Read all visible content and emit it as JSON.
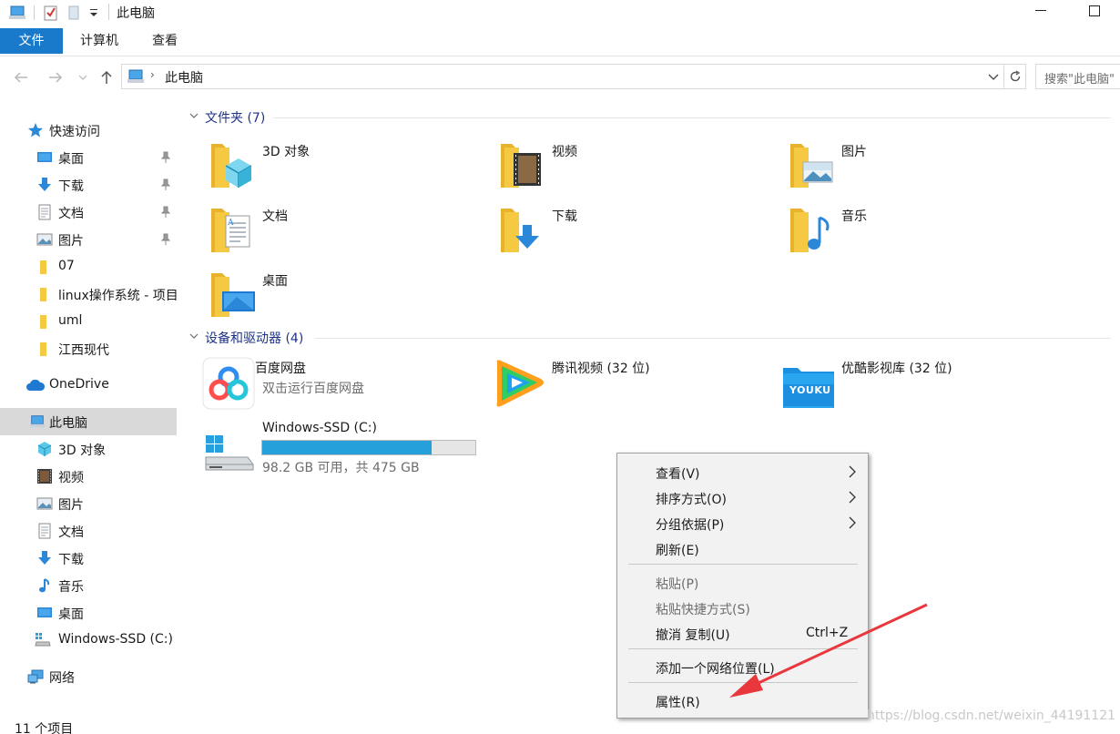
{
  "window": {
    "title": "此电脑"
  },
  "ribbon": {
    "tabs": [
      "文件",
      "计算机",
      "查看"
    ]
  },
  "address": {
    "path": "此电脑",
    "search_placeholder": "搜索\"此电脑\""
  },
  "sidebar": {
    "quick_access": "快速访问",
    "pinned": [
      {
        "label": "桌面",
        "icon": "desktop-icon"
      },
      {
        "label": "下载",
        "icon": "download-icon"
      },
      {
        "label": "文档",
        "icon": "document-icon"
      },
      {
        "label": "图片",
        "icon": "pictures-icon"
      }
    ],
    "recent": [
      "07",
      "linux操作系统 - 项目",
      "uml",
      "江西现代"
    ],
    "onedrive": "OneDrive",
    "this_pc": "此电脑",
    "this_pc_children": [
      {
        "label": "3D 对象",
        "icon": "3d-objects-icon"
      },
      {
        "label": "视频",
        "icon": "videos-icon"
      },
      {
        "label": "图片",
        "icon": "pictures-icon"
      },
      {
        "label": "文档",
        "icon": "document-icon"
      },
      {
        "label": "下载",
        "icon": "download-icon"
      },
      {
        "label": "音乐",
        "icon": "music-icon"
      },
      {
        "label": "桌面",
        "icon": "desktop-icon"
      },
      {
        "label": "Windows-SSD (C:)",
        "icon": "drive-icon"
      }
    ],
    "network": "网络"
  },
  "content": {
    "folders_header": "文件夹 (7)",
    "folders": [
      {
        "name": "3D 对象",
        "icon": "3d-objects-icon"
      },
      {
        "name": "视频",
        "icon": "videos-icon"
      },
      {
        "name": "图片",
        "icon": "pictures-icon"
      },
      {
        "name": "文档",
        "icon": "document-icon"
      },
      {
        "name": "下载",
        "icon": "download-icon"
      },
      {
        "name": "音乐",
        "icon": "music-icon"
      },
      {
        "name": "桌面",
        "icon": "desktop-icon"
      }
    ],
    "devices_header": "设备和驱动器 (4)",
    "devices": [
      {
        "name": "百度网盘",
        "sub": "双击运行百度网盘",
        "icon": "baidu-netdisk-icon"
      },
      {
        "name": "腾讯视频 (32 位)",
        "icon": "tencent-video-icon"
      },
      {
        "name": "优酷影视库 (32 位)",
        "icon": "youku-icon",
        "logo_text": "YOUKU"
      }
    ],
    "drive": {
      "name": "Windows-SSD (C:)",
      "free_text": "98.2 GB 可用，共 475 GB",
      "used_fraction": 0.793,
      "icon": "drive-icon"
    }
  },
  "context_menu": {
    "items": [
      {
        "label": "查看(V)",
        "submenu": true
      },
      {
        "label": "排序方式(O)",
        "submenu": true
      },
      {
        "label": "分组依据(P)",
        "submenu": true
      },
      {
        "label": "刷新(E)"
      },
      {
        "label": "粘贴(P)",
        "disabled": true
      },
      {
        "label": "粘贴快捷方式(S)",
        "disabled": true
      },
      {
        "label": "撤消 复制(U)",
        "shortcut": "Ctrl+Z"
      },
      {
        "label": "添加一个网络位置(L)"
      },
      {
        "label": "属性(R)"
      }
    ]
  },
  "status": {
    "item_count": "11 个项目"
  },
  "watermark": "https://blog.csdn.net/weixin_44191121",
  "colors": {
    "accent": "#1979ca",
    "folder": "#f5c942",
    "drive_bar": "#26a0da",
    "annotation_arrow": "#e8383d"
  }
}
